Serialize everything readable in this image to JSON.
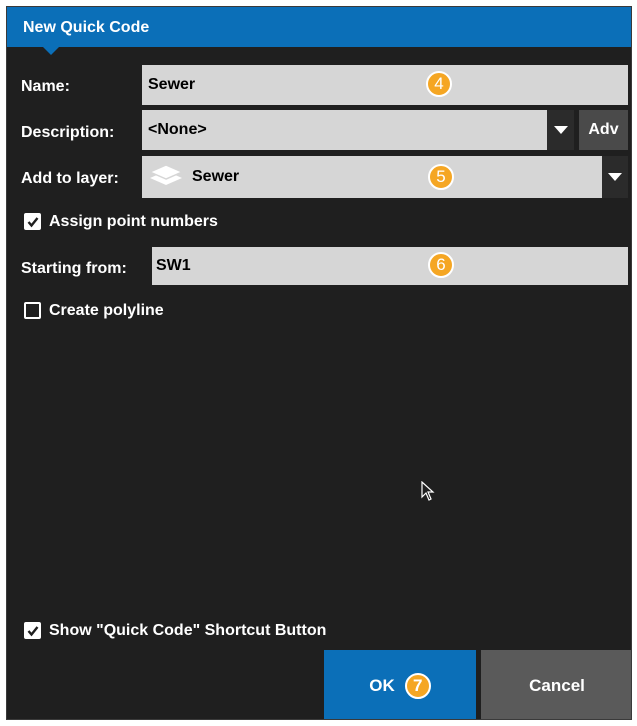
{
  "dialog": {
    "title": "New Quick Code"
  },
  "form": {
    "name_label": "Name:",
    "name_value": "Sewer",
    "description_label": "Description:",
    "description_value": "<None>",
    "adv_label": "Adv",
    "layer_label": "Add to layer:",
    "layer_value": "Sewer",
    "assign_label": "Assign point numbers",
    "assign_checked": true,
    "starting_label": "Starting from:",
    "starting_value": "SW1",
    "polyline_label": "Create polyline",
    "polyline_checked": false,
    "shortcut_label": "Show \"Quick Code\" Shortcut Button",
    "shortcut_checked": true
  },
  "buttons": {
    "ok_label": "OK",
    "cancel_label": "Cancel"
  },
  "callouts": {
    "name": "4",
    "layer": "5",
    "starting": "6",
    "ok": "7"
  },
  "colors": {
    "accent": "#0b6fb8",
    "badge": "#f5a623",
    "field_bg": "#d6d6d6",
    "dialog_bg": "#1f1f1f"
  }
}
